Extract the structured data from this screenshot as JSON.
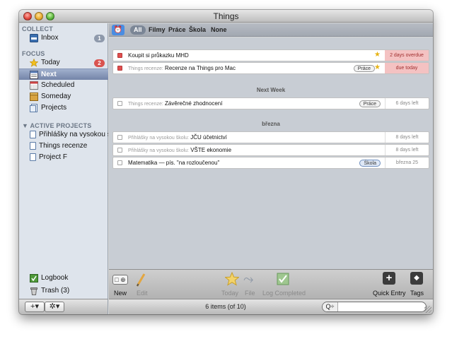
{
  "window": {
    "title": "Things"
  },
  "sidebar": {
    "collect_label": "COLLECT",
    "inbox": {
      "label": "Inbox",
      "badge": "1"
    },
    "focus_label": "FOCUS",
    "today": {
      "label": "Today",
      "badge": "2"
    },
    "next": {
      "label": "Next"
    },
    "scheduled": {
      "label": "Scheduled"
    },
    "someday": {
      "label": "Someday"
    },
    "projects": {
      "label": "Projects"
    },
    "active_projects_label": "▼ ACTIVE PROJECTS",
    "active_projects": [
      "Přihlášky na vysokou š...",
      "Things recenze",
      "Project F"
    ],
    "logbook": {
      "label": "Logbook"
    },
    "trash": {
      "label": "Trash (3)"
    }
  },
  "filters": [
    "All",
    "Filmy",
    "Práce",
    "Škola",
    "None"
  ],
  "tasks": {
    "overdue": [
      {
        "prefix": "",
        "title": "Koupit si průkazku MHD",
        "tag": "",
        "due": "2 days overdue"
      },
      {
        "prefix": "Things recenze:",
        "title": "Recenze na Things pro Mac",
        "tag": "Práce",
        "due": "due today"
      }
    ],
    "next_week_header": "Next Week",
    "next_week": [
      {
        "prefix": "Things recenze:",
        "title": "Závěrečné zhodnocení",
        "tag": "Práce",
        "due": "6 days left"
      }
    ],
    "brezna_header": "března",
    "brezna": [
      {
        "prefix": "Přihlášky na vysokou školu:",
        "title": "JČU účetnictví",
        "tag": "",
        "due": "8 days left"
      },
      {
        "prefix": "Přihlášky na vysokou školu:",
        "title": "VŠTE ekonomie",
        "tag": "",
        "due": "8 days left"
      },
      {
        "prefix": "",
        "title": "Matematika — pís. \"na rozloučenou\"",
        "tag": "Škola",
        "due": "března 25"
      }
    ]
  },
  "toolbar": {
    "new": "New",
    "edit": "Edit",
    "today": "Today",
    "file": "File",
    "log_completed": "Log Completed",
    "quick_entry": "Quick Entry",
    "tags": "Tags"
  },
  "status": "6 items (of 10)",
  "search": {
    "placeholder": ""
  },
  "bottom": {
    "add": "+▾",
    "gear": "✲▾"
  },
  "colors": {
    "selection": "#7384a8",
    "overdue": "#f4c2c2",
    "alarm": "#4a8de2",
    "badge_inbox": "#8e99ab",
    "badge_today": "#d9534f"
  }
}
